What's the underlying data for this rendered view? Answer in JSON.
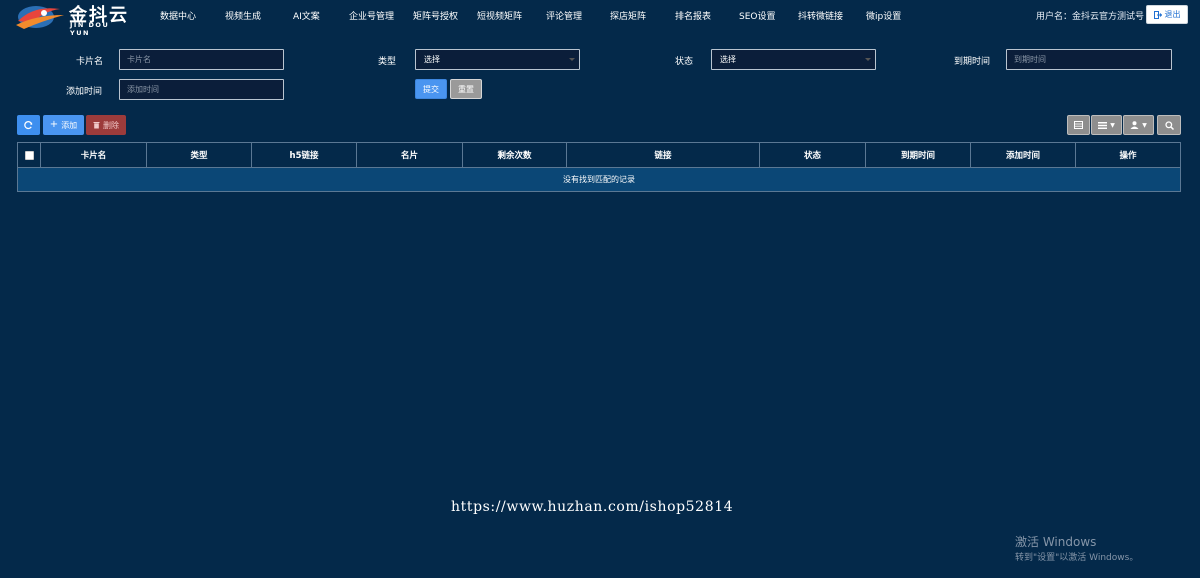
{
  "brand": {
    "title": "金抖云",
    "subtitle": "JIN DOU YUN"
  },
  "nav": {
    "items": [
      "数据中心",
      "视频生成",
      "AI文案",
      "企业号管理",
      "矩阵号授权",
      "短视频矩阵",
      "评论管理",
      "探店矩阵",
      "排名报表",
      "SEO设置",
      "抖转微链接",
      "微ip设置"
    ]
  },
  "user": {
    "label": "用户名：金抖云官方测试号",
    "logout": "退出"
  },
  "filters": {
    "card_name_label": "卡片名",
    "card_name_placeholder": "卡片名",
    "type_label": "类型",
    "type_value": "选择",
    "status_label": "状态",
    "status_value": "选择",
    "expire_label": "到期时间",
    "expire_placeholder": "到期时间",
    "added_label": "添加时间",
    "added_placeholder": "添加时间",
    "submit": "提交",
    "reset": "重置"
  },
  "toolbar": {
    "add": "添加",
    "delete": "删除"
  },
  "table": {
    "columns": [
      "卡片名",
      "类型",
      "h5链接",
      "名片",
      "剩余次数",
      "链接",
      "状态",
      "到期时间",
      "添加时间",
      "操作"
    ],
    "empty_text": "没有找到匹配的记录"
  },
  "watermark": "https://www.huzhan.com/ishop52814",
  "windows": {
    "title": "激活 Windows",
    "subtitle": "转到\"设置\"以激活 Windows。"
  },
  "colors": {
    "background": "#04294a",
    "primary": "#4a95f0",
    "danger": "#9c3b3b",
    "row_highlight": "#0b4776"
  }
}
